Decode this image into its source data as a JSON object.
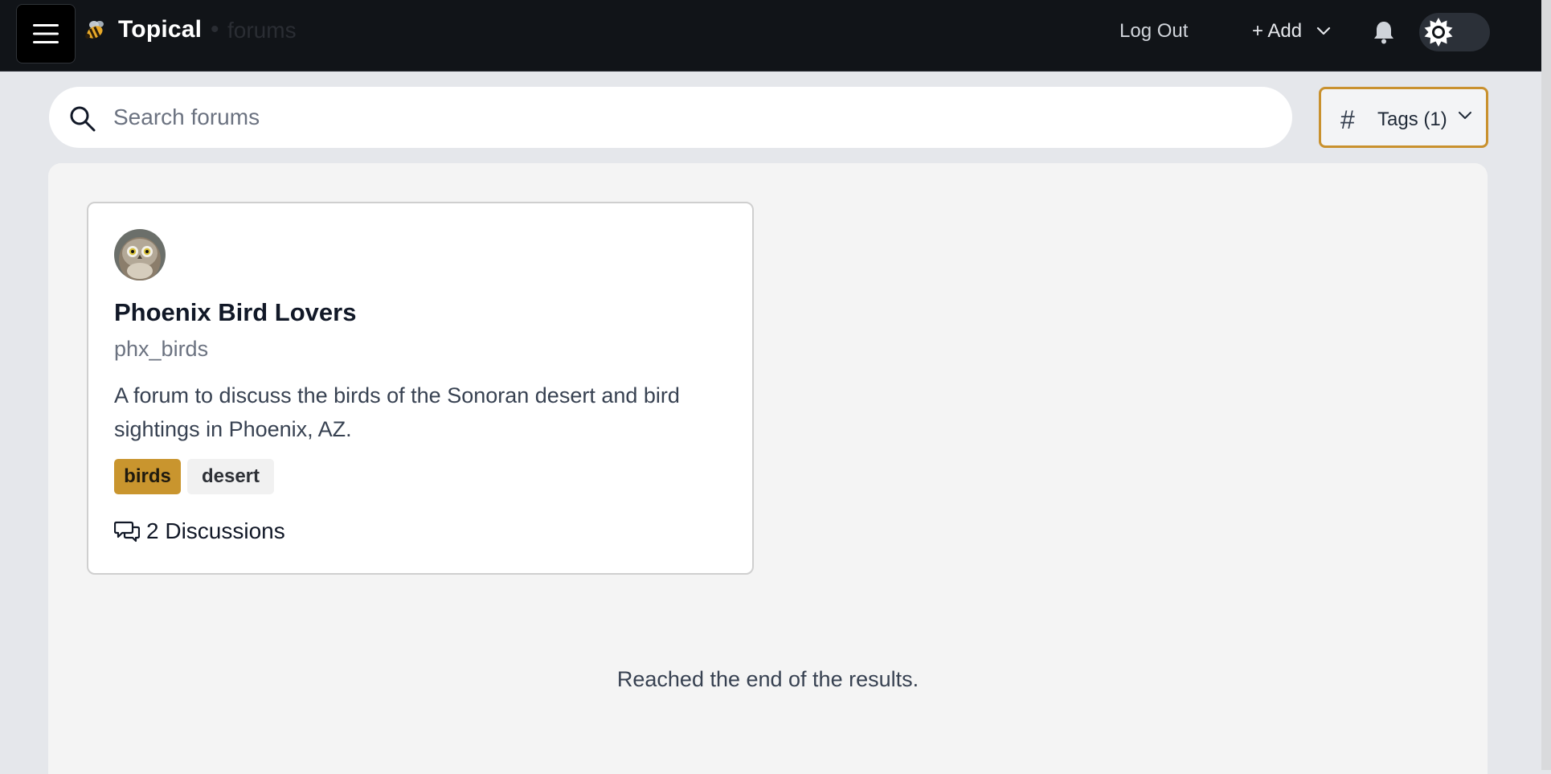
{
  "header": {
    "app_name": "Topical",
    "separator": "•",
    "section": "forums",
    "logout_label": "Log Out",
    "add_label": "+ Add",
    "icons": [
      "menu-icon",
      "bee-logo-icon",
      "chevron-down-icon",
      "bell-icon",
      "sun-icon"
    ]
  },
  "search": {
    "placeholder": "Search forums",
    "value": ""
  },
  "tags_filter": {
    "symbol": "#",
    "label": "Tags (1)"
  },
  "forums": [
    {
      "title": "Phoenix Bird Lovers",
      "handle": "phx_birds",
      "description": "A forum to discuss the birds of the Sonoran desert and bird sightings in Phoenix, AZ.",
      "tags": [
        {
          "label": "birds",
          "selected": true
        },
        {
          "label": "desert",
          "selected": false
        }
      ],
      "discussions_label": "2 Discussions"
    }
  ],
  "end_message": "Reached the end of the results.",
  "colors": {
    "nav_bg": "#111418",
    "accent": "#c9912e",
    "page_bg": "#e5e7eb",
    "panel_bg": "#f4f4f4"
  }
}
